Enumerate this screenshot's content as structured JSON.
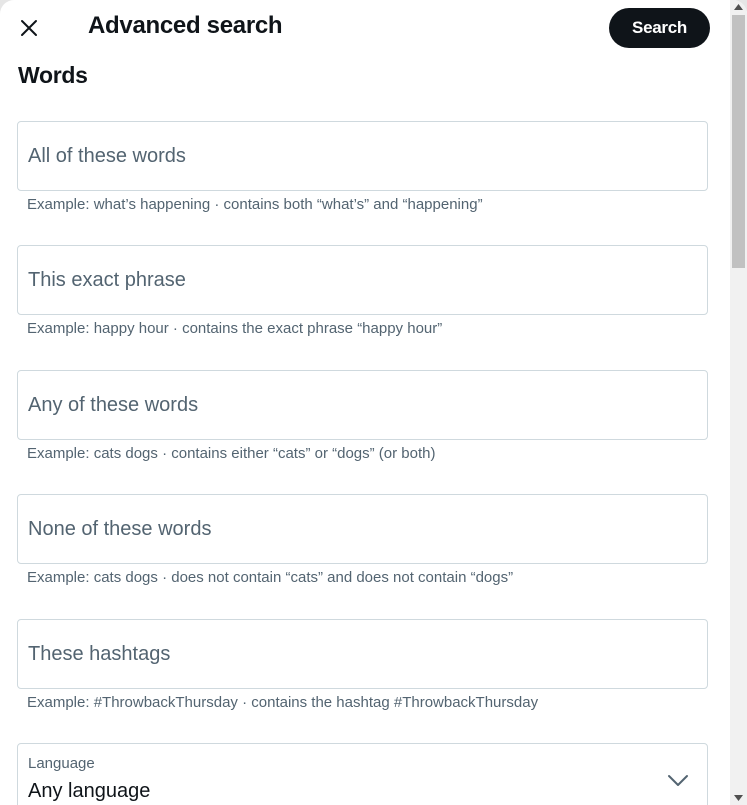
{
  "header": {
    "title": "Advanced search",
    "close_icon": "close-icon",
    "search_button_label": "Search"
  },
  "section": {
    "title": "Words"
  },
  "fields": [
    {
      "placeholder": "All of these words",
      "value": "",
      "hint": "Example: what’s happening · contains both “what’s” and “happening”"
    },
    {
      "placeholder": "This exact phrase",
      "value": "",
      "hint": "Example: happy hour · contains the exact phrase “happy hour”"
    },
    {
      "placeholder": "Any of these words",
      "value": "",
      "hint": "Example: cats dogs · contains either “cats” or “dogs” (or both)"
    },
    {
      "placeholder": "None of these words",
      "value": "",
      "hint": "Example: cats dogs · does not contain “cats” and does not contain “dogs”"
    },
    {
      "placeholder": "These hashtags",
      "value": "",
      "hint": "Example: #ThrowbackThursday · contains the hashtag #ThrowbackThursday"
    }
  ],
  "language": {
    "label": "Language",
    "selected": "Any language",
    "icon": "chevron-down-icon"
  },
  "colors": {
    "primary_text": "#0f1419",
    "secondary_text": "#536471",
    "border": "#cfd9de",
    "button_bg": "#0f1419",
    "button_text": "#ffffff"
  }
}
